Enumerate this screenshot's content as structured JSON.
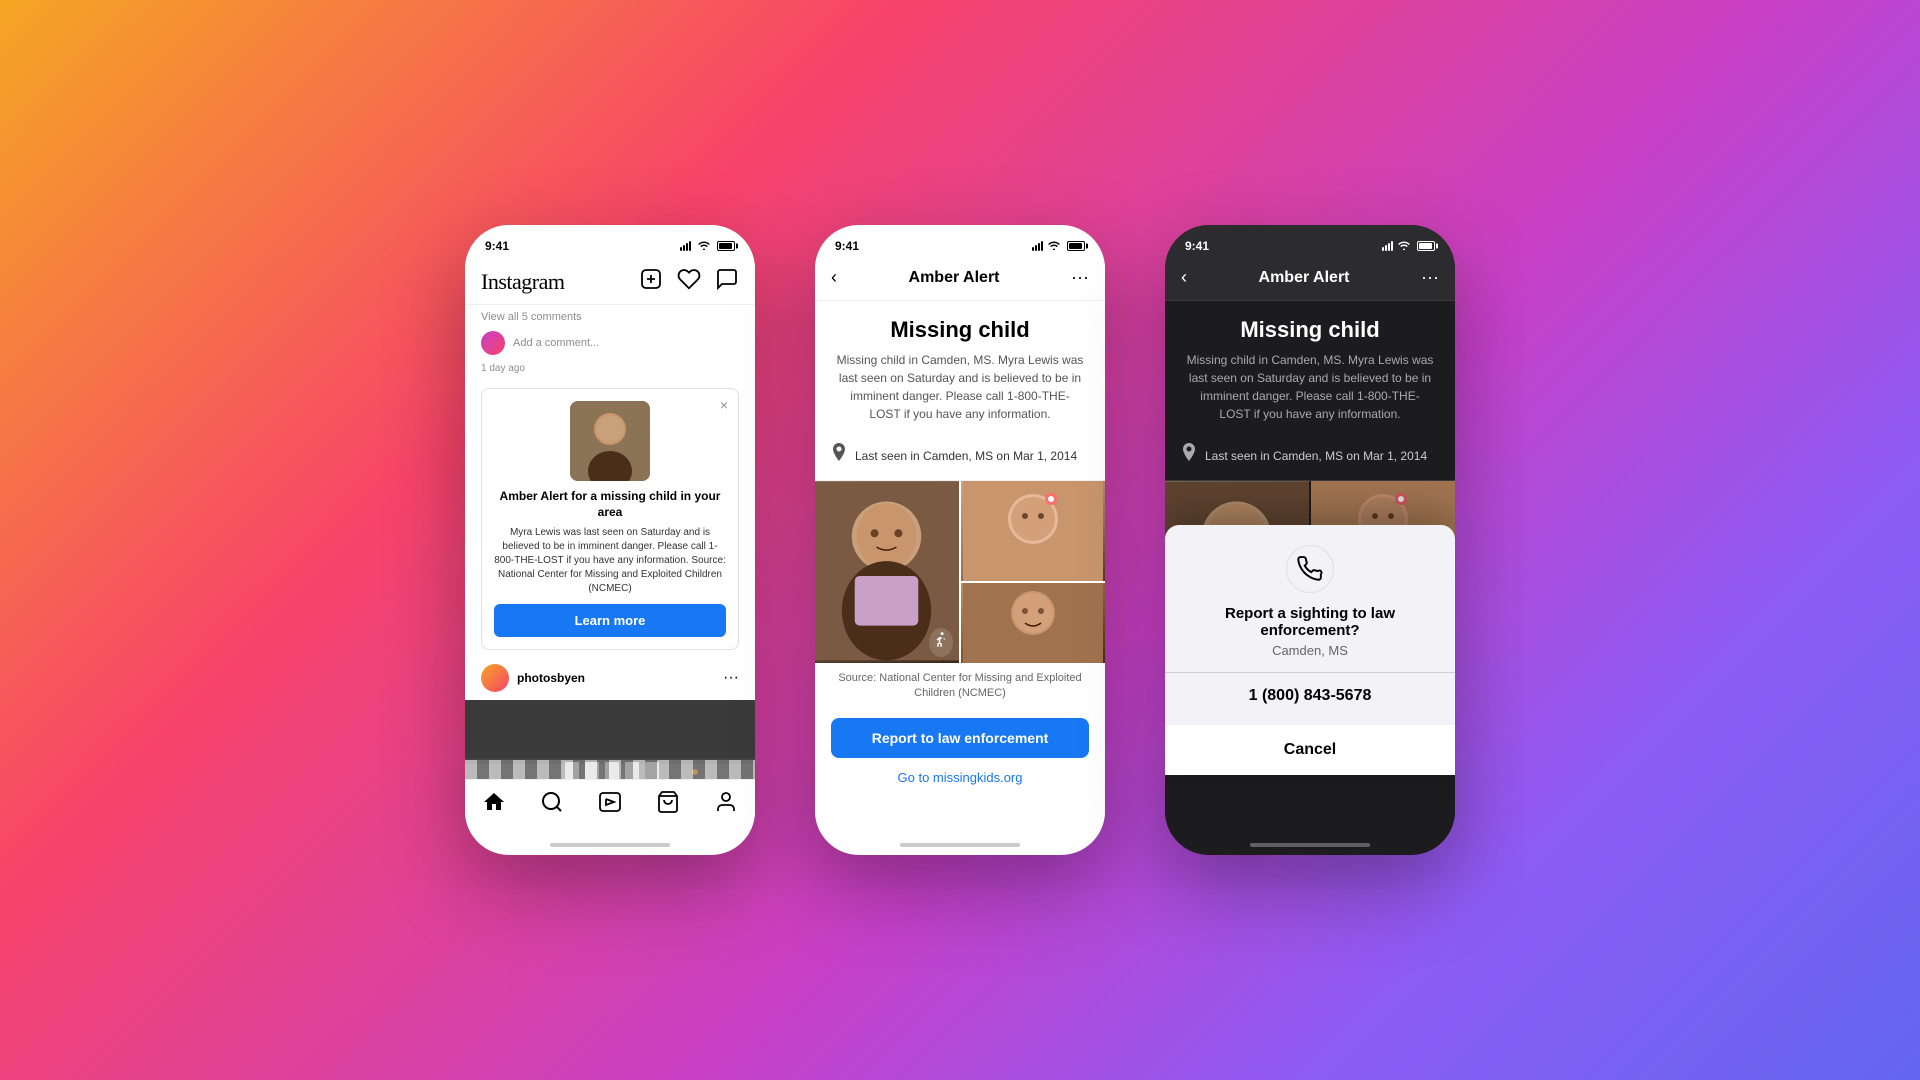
{
  "background": {
    "gradient": "linear-gradient(135deg, #f5a623 0%, #f7436a 30%, #c640c8 60%, #8b5cf6 80%, #6366f1 100%)"
  },
  "phone1": {
    "status_time": "9:41",
    "header_logo": "Instagram",
    "header_icons": [
      "add",
      "heart",
      "messenger"
    ],
    "view_comments": "View all 5 comments",
    "comment_placeholder": "Add a comment...",
    "timestamp": "1 day ago",
    "amber_card": {
      "title": "Amber Alert for a missing child in your area",
      "description": "Myra Lewis was last seen on Saturday and is believed to be in imminent danger. Please call 1-800-THE-LOST if you have any information. Source: National Center for Missing and Exploited Children (NCMEC)",
      "button_label": "Learn more"
    },
    "post_username": "photosbyen",
    "nav_items": [
      "home",
      "search",
      "reels",
      "shop",
      "profile"
    ]
  },
  "phone2": {
    "status_time": "9:41",
    "header_title": "Amber Alert",
    "header_more": "...",
    "missing_title": "Missing child",
    "missing_description": "Missing child in Camden, MS. Myra Lewis was last seen on Saturday and is believed to be in imminent danger. Please call 1-800-THE-LOST if you have any information.",
    "location_text": "Last seen in Camden, MS on Mar 1, 2014",
    "source_text": "Source: National Center for Missing and Exploited Children (NCMEC)",
    "report_button": "Report to law enforcement",
    "link_text": "Go to missingkids.org"
  },
  "phone3": {
    "status_time": "9:41",
    "header_title": "Amber Alert",
    "missing_title": "Missing child",
    "missing_description": "Missing child in Camden, MS. Myra Lewis was last seen on Saturday and is believed to be in imminent danger. Please call 1-800-THE-LOST if you have any information.",
    "location_text": "Last seen in Camden, MS on Mar 1, 2014",
    "dialog": {
      "title": "Report a sighting to law enforcement?",
      "subtitle": "Camden, MS",
      "phone_number": "1 (800) 843-5678",
      "cancel_label": "Cancel"
    }
  }
}
